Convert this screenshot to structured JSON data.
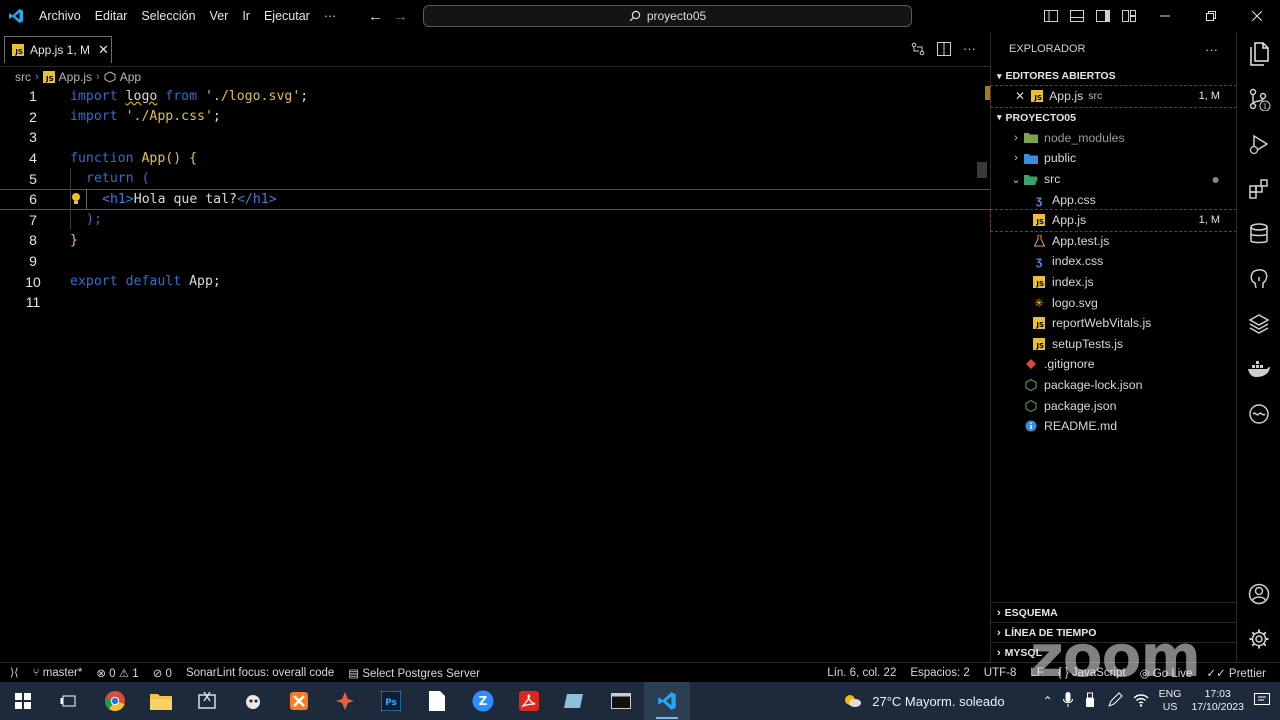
{
  "titlebar": {
    "menu": [
      "Archivo",
      "Editar",
      "Selección",
      "Ver",
      "Ir",
      "Ejecutar",
      "···"
    ],
    "search": "proyecto05"
  },
  "tab": {
    "label": "App.js 1, M"
  },
  "breadcrumb": [
    "src",
    "App.js",
    "App"
  ],
  "code": {
    "lines": [
      {
        "n": "1"
      },
      {
        "n": "2"
      },
      {
        "n": "3"
      },
      {
        "n": "4"
      },
      {
        "n": "5"
      },
      {
        "n": "6"
      },
      {
        "n": "7"
      },
      {
        "n": "8"
      },
      {
        "n": "9"
      },
      {
        "n": "10"
      },
      {
        "n": "11"
      }
    ],
    "l1": {
      "a": "import ",
      "b": "logo",
      "c": " from ",
      "d": "'./logo.svg'",
      "e": ";"
    },
    "l2": {
      "a": "import ",
      "b": "'./App.css'",
      "c": ";"
    },
    "l4": {
      "a": "function ",
      "b": "App",
      "c": "() {"
    },
    "l5": {
      "a": "return",
      "b": " ("
    },
    "l6": {
      "a": "<h1>",
      "b": "Hola que tal?",
      "c": "</h1>"
    },
    "l7": {
      "a": ");"
    },
    "l8": {
      "a": "}"
    },
    "l10": {
      "a": "export default ",
      "b": "App",
      "c": ";"
    }
  },
  "sidebar": {
    "title": "EXPLORADOR",
    "open_editors": "EDITORES ABIERTOS",
    "open_file": {
      "name": "App.js",
      "dir": "src",
      "badge": "1, M"
    },
    "project": "PROYECTO05",
    "tree": [
      {
        "name": "node_modules",
        "kind": "folder-closed"
      },
      {
        "name": "public",
        "kind": "folder-closed"
      },
      {
        "name": "src",
        "kind": "folder-open"
      },
      {
        "name": "App.css",
        "kind": "css"
      },
      {
        "name": "App.js",
        "kind": "js",
        "badge": "1, M"
      },
      {
        "name": "App.test.js",
        "kind": "test"
      },
      {
        "name": "index.css",
        "kind": "css"
      },
      {
        "name": "index.js",
        "kind": "js"
      },
      {
        "name": "logo.svg",
        "kind": "svg"
      },
      {
        "name": "reportWebVitals.js",
        "kind": "js"
      },
      {
        "name": "setupTests.js",
        "kind": "js"
      },
      {
        "name": ".gitignore",
        "kind": "git"
      },
      {
        "name": "package-lock.json",
        "kind": "npm"
      },
      {
        "name": "package.json",
        "kind": "npm"
      },
      {
        "name": "README.md",
        "kind": "info"
      }
    ],
    "bottom_sections": [
      "ESQUEMA",
      "LÍNEA DE TIEMPO",
      "MYSQL"
    ]
  },
  "statusbar": {
    "branch": "master*",
    "errors": "0",
    "warnings": "1",
    "ports": "0",
    "sonar": "SonarLint focus: overall code",
    "postgres": "Select Postgres Server",
    "position": "Lín. 6, col. 22",
    "spaces": "Espacios: 2",
    "encoding": "UTF-8",
    "eol": "LF",
    "language": "JavaScript",
    "golive": "Go Live",
    "prettier": "Prettier"
  },
  "taskbar": {
    "weather": "27°C  Mayorm. soleado",
    "lang": "ENG",
    "region": "US",
    "time": "17:03",
    "date": "17/10/2023"
  },
  "watermark": "zoom",
  "colors": {
    "accent": "#0078d4",
    "squiggle": "#c8a000",
    "keyword": "#2d6fd0",
    "string": "#e0c040"
  }
}
